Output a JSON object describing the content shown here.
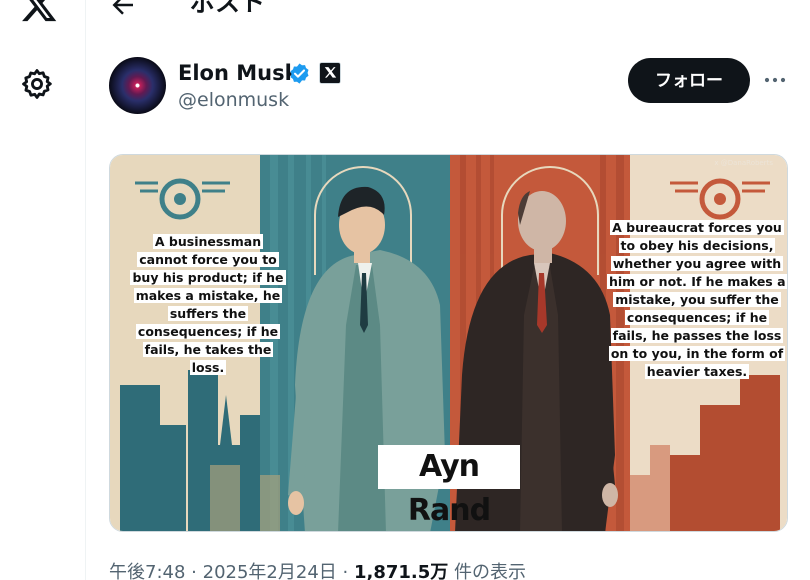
{
  "header": {
    "title": "ポスト"
  },
  "sidebar": {
    "icons": [
      "x-logo-icon",
      "settings-gear-icon"
    ]
  },
  "author": {
    "name": "Elon Musk",
    "handle": "@elonmusk",
    "verified": true
  },
  "actions": {
    "follow_label": "フォロー",
    "more_icon": "more-horizontal-icon"
  },
  "media": {
    "watermark": "x @DanaRoberts",
    "quote_left": "A businessman cannot force you to buy his product; if he makes a mistake, he suffers the consequences; if he fails, he takes the loss.",
    "quote_right": "A bureaucrat forces you to obey his decisions, whether you agree with him or not. If he makes a mistake, you suffer the consequences; if he fails, he passes the loss on to you, in the form of heavier taxes.",
    "caption": "Ayn Rand"
  },
  "meta": {
    "time": "午後7:48",
    "date": "2025年2月24日",
    "separator": "·",
    "views": "1,871.5万",
    "views_label": "件の表示"
  },
  "colors": {
    "accent": "#1d9bf0",
    "follow_bg": "#0f1419",
    "secondary_text": "#536471",
    "left_panel": "#3d7d86",
    "right_panel": "#c2573a"
  }
}
